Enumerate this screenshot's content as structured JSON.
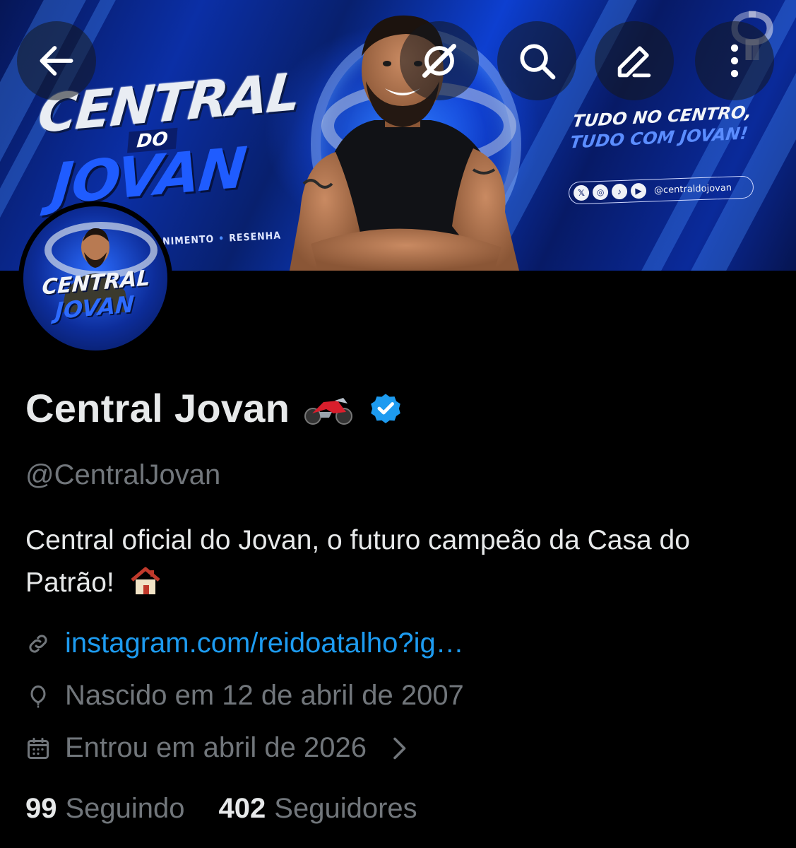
{
  "header": {
    "back_icon": "arrow-left-icon",
    "actions": [
      "grok-icon",
      "search-icon",
      "edit-icon",
      "more-vertical-icon"
    ]
  },
  "banner": {
    "title_top": "CENTRAL",
    "title_mid": "DO",
    "title_bottom": "JOVAN",
    "subtitle_a": "NIMENTO",
    "subtitle_b": "RESENHA",
    "slogan_line1": "TUDO NO CENTRO,",
    "slogan_line2": "TUDO COM JOVAN!",
    "social_handle": "@centraldojovan",
    "social_icons": [
      "x-icon",
      "instagram-icon",
      "tiktok-icon",
      "youtube-icon"
    ]
  },
  "avatar": {
    "line1": "CENTRAL",
    "line2": "JOVAN"
  },
  "profile": {
    "name": "Central Jovan",
    "name_emoji": "motorcycle-icon",
    "verified": true,
    "handle": "@CentralJovan",
    "bio": "Central oficial do Jovan, o futuro campeão da Casa do Patrão!",
    "bio_emoji": "house-icon",
    "link": "instagram.com/reidoatalho?ig…",
    "birth": "Nascido em 12 de abril de 2007",
    "joined": "Entrou em abril de 2026"
  },
  "stats": {
    "following_count": "99",
    "following_label": "Seguindo",
    "followers_count": "402",
    "followers_label": "Seguidores"
  },
  "colors": {
    "background": "#000000",
    "text_primary": "#e7e9ea",
    "text_secondary": "#71767b",
    "link": "#1d9bf0",
    "verified": "#1d9bf0"
  }
}
